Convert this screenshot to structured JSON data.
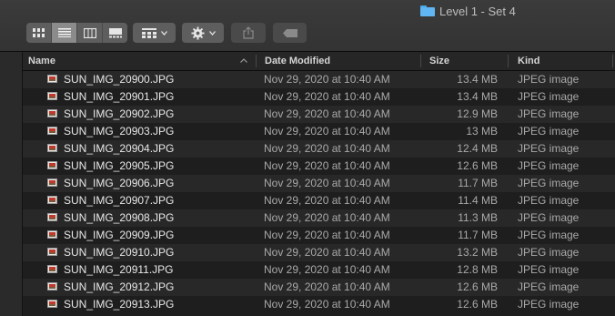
{
  "window": {
    "title": "Level 1 - Set 4"
  },
  "toolbar": {
    "view_icons": [
      "icon-view-icon",
      "list-view-icon",
      "column-view-icon",
      "gallery-view-icon"
    ],
    "active_view": "list-view-icon",
    "group_menu_icon": "group-grid-icon",
    "action_menu_icon": "gear-icon",
    "share_icon": "share-icon",
    "tag_icon": "tag-icon"
  },
  "columns": {
    "name": "Name",
    "date": "Date Modified",
    "size": "Size",
    "kind": "Kind",
    "sort_indicator": "chevron-up-icon"
  },
  "files": [
    {
      "name": "SUN_IMG_20900.JPG",
      "date": "Nov 29, 2020 at 10:40 AM",
      "size": "13.4 MB",
      "kind": "JPEG image"
    },
    {
      "name": "SUN_IMG_20901.JPG",
      "date": "Nov 29, 2020 at 10:40 AM",
      "size": "13.4 MB",
      "kind": "JPEG image"
    },
    {
      "name": "SUN_IMG_20902.JPG",
      "date": "Nov 29, 2020 at 10:40 AM",
      "size": "12.9 MB",
      "kind": "JPEG image"
    },
    {
      "name": "SUN_IMG_20903.JPG",
      "date": "Nov 29, 2020 at 10:40 AM",
      "size": "13 MB",
      "kind": "JPEG image"
    },
    {
      "name": "SUN_IMG_20904.JPG",
      "date": "Nov 29, 2020 at 10:40 AM",
      "size": "12.4 MB",
      "kind": "JPEG image"
    },
    {
      "name": "SUN_IMG_20905.JPG",
      "date": "Nov 29, 2020 at 10:40 AM",
      "size": "12.6 MB",
      "kind": "JPEG image"
    },
    {
      "name": "SUN_IMG_20906.JPG",
      "date": "Nov 29, 2020 at 10:40 AM",
      "size": "11.7 MB",
      "kind": "JPEG image"
    },
    {
      "name": "SUN_IMG_20907.JPG",
      "date": "Nov 29, 2020 at 10:40 AM",
      "size": "11.4 MB",
      "kind": "JPEG image"
    },
    {
      "name": "SUN_IMG_20908.JPG",
      "date": "Nov 29, 2020 at 10:40 AM",
      "size": "11.3 MB",
      "kind": "JPEG image"
    },
    {
      "name": "SUN_IMG_20909.JPG",
      "date": "Nov 29, 2020 at 10:40 AM",
      "size": "11.7 MB",
      "kind": "JPEG image"
    },
    {
      "name": "SUN_IMG_20910.JPG",
      "date": "Nov 29, 2020 at 10:40 AM",
      "size": "13.2 MB",
      "kind": "JPEG image"
    },
    {
      "name": "SUN_IMG_20911.JPG",
      "date": "Nov 29, 2020 at 10:40 AM",
      "size": "12.8 MB",
      "kind": "JPEG image"
    },
    {
      "name": "SUN_IMG_20912.JPG",
      "date": "Nov 29, 2020 at 10:40 AM",
      "size": "12.6 MB",
      "kind": "JPEG image"
    },
    {
      "name": "SUN_IMG_20913.JPG",
      "date": "Nov 29, 2020 at 10:40 AM",
      "size": "12.6 MB",
      "kind": "JPEG image"
    }
  ]
}
